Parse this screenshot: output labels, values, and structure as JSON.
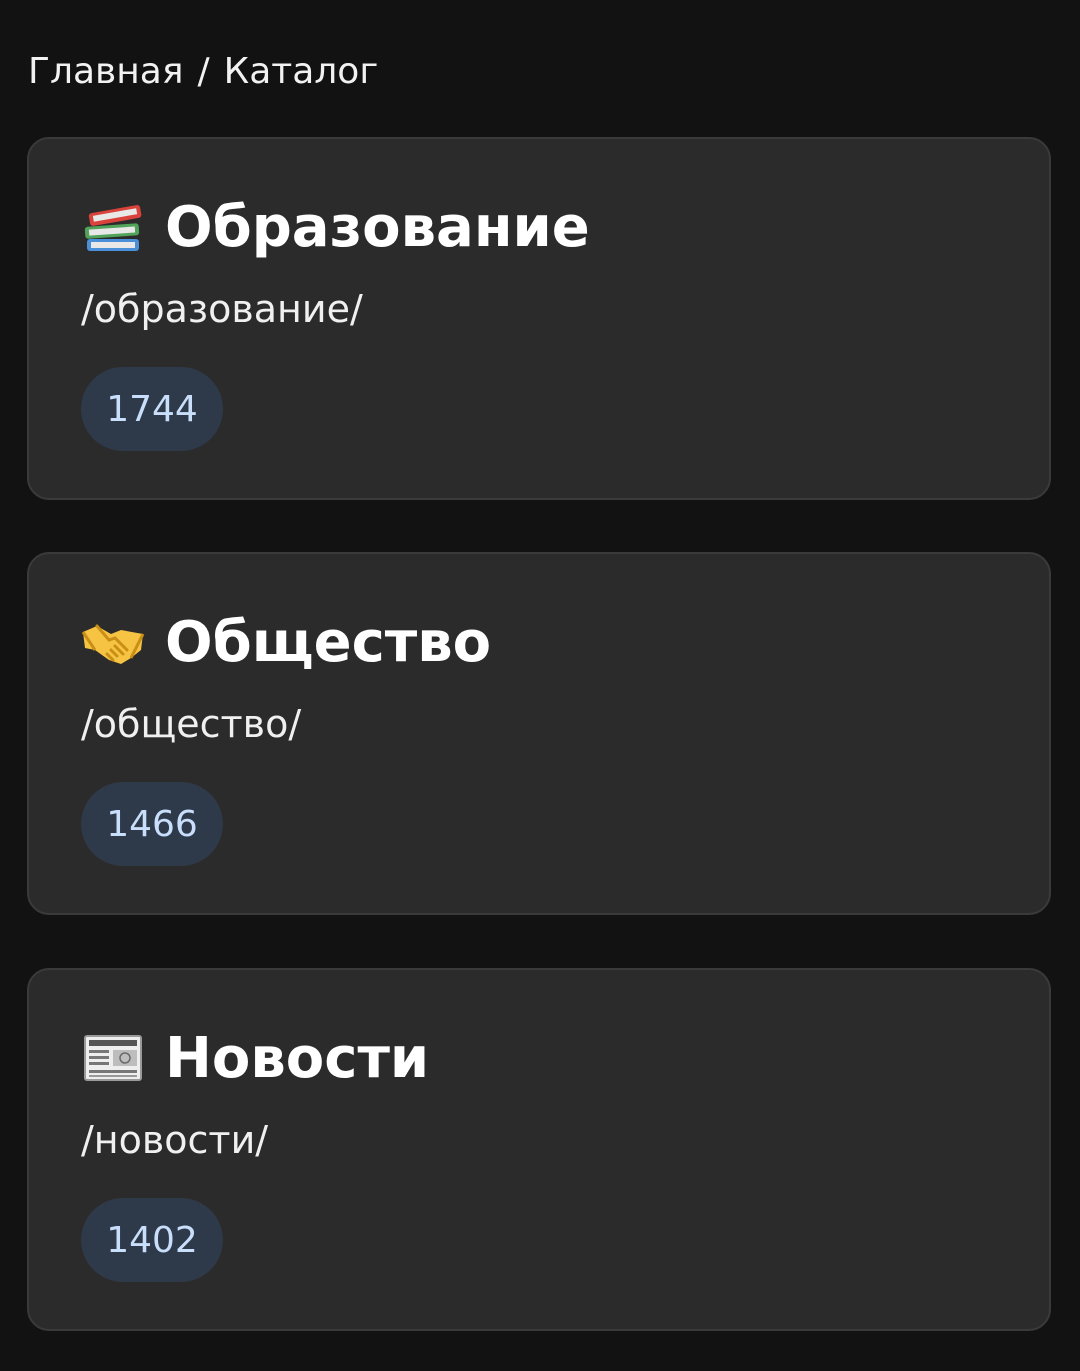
{
  "breadcrumb": {
    "home": "Главная",
    "separator": "/",
    "current": "Каталог"
  },
  "categories": [
    {
      "icon": "books-icon",
      "title": "Образование",
      "path": "/образование/",
      "count": "1744"
    },
    {
      "icon": "handshake-icon",
      "title": "Общество",
      "path": "/общество/",
      "count": "1466"
    },
    {
      "icon": "newspaper-icon",
      "title": "Новости",
      "path": "/новости/",
      "count": "1402"
    }
  ],
  "colors": {
    "background": "#121212",
    "card": "#2b2b2b",
    "card_border": "#3a3a3a",
    "badge_bg": "#2e3a4a",
    "badge_text": "#c9defa"
  }
}
